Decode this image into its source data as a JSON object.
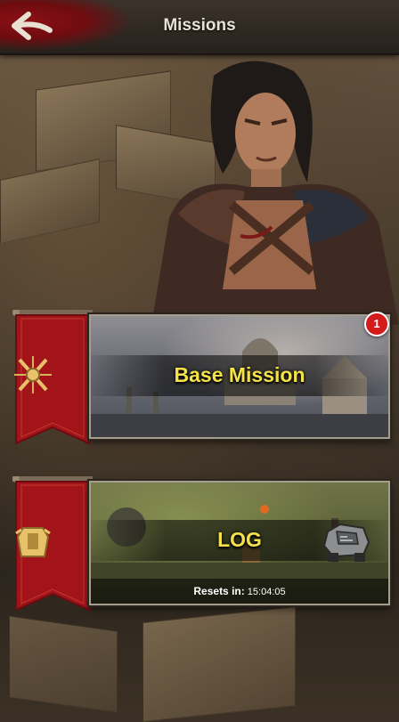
{
  "header": {
    "title": "Missions",
    "back_icon": "back-arrow-icon"
  },
  "missions": [
    {
      "label": "Base Mission",
      "badge_count": "1",
      "banner_icon": "crossed-swords-emblem-icon"
    },
    {
      "label": "LOG",
      "banner_icon": "armor-emblem-icon",
      "reward_icon": "armored-vehicle-icon",
      "reset_label": "Resets in:",
      "reset_time": "15:04:05"
    }
  ],
  "colors": {
    "accent_yellow": "#f5e24a",
    "banner_red": "#a3141a",
    "badge_red": "#d31b1b"
  }
}
